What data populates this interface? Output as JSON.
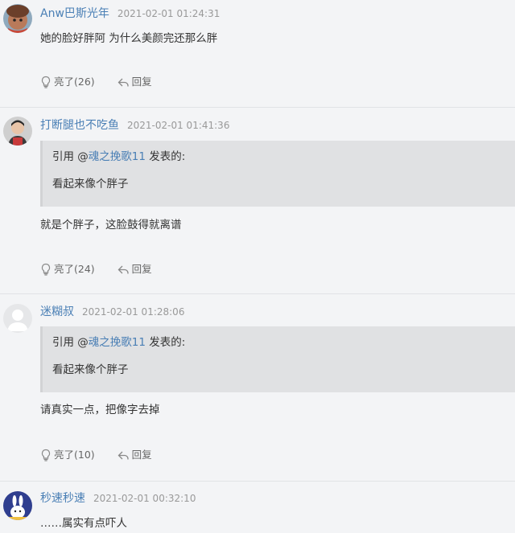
{
  "comments": [
    {
      "username": "Anw巴斯光年",
      "time": "2021-02-01 01:24:31",
      "text": "她的脸好胖阿 为什么美颜完还那么胖",
      "like_label": "亮了(26)",
      "reply_label": "回复"
    },
    {
      "username": "打断腿也不吃鱼",
      "time": "2021-02-01 01:41:36",
      "quote": {
        "prefix": "引用 @",
        "user": "魂之挽歌11",
        "suffix": " 发表的:",
        "text": "看起来像个胖子"
      },
      "text": "就是个胖子，这脸鼓得就离谱",
      "like_label": "亮了(24)",
      "reply_label": "回复"
    },
    {
      "username": "迷糊叔",
      "time": "2021-02-01 01:28:06",
      "quote": {
        "prefix": "引用 @",
        "user": "魂之挽歌11",
        "suffix": " 发表的:",
        "text": "看起来像个胖子"
      },
      "text": "请真实一点，把像字去掉",
      "like_label": "亮了(10)",
      "reply_label": "回复"
    },
    {
      "username": "秒速秒速",
      "time": "2021-02-01 00:32:10",
      "text": "……属实有点吓人"
    }
  ],
  "colors": {
    "background": "#f3f4f6",
    "username": "#4a7fb5",
    "quote_background": "#e0e1e3",
    "timestamp": "#999999"
  }
}
